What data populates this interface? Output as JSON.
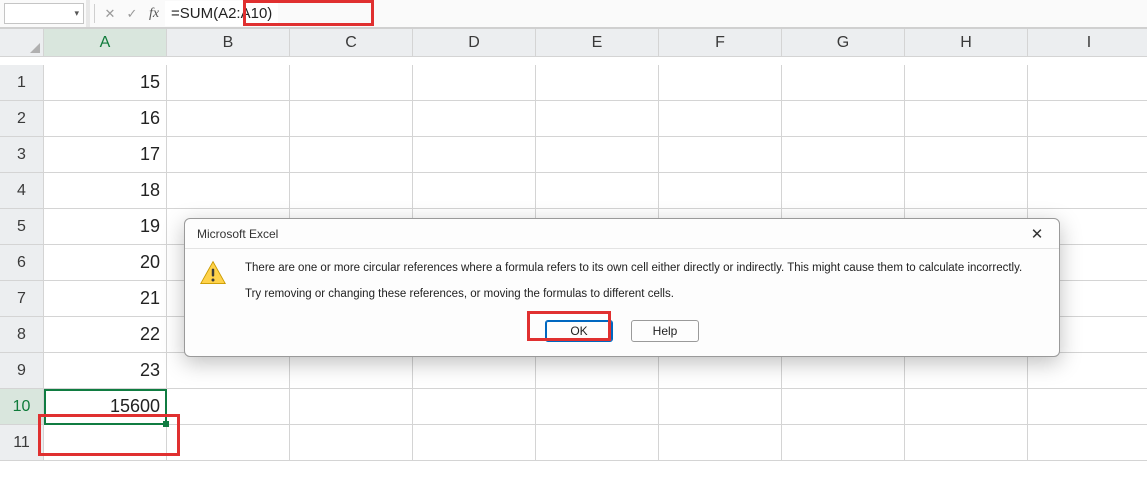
{
  "formula_bar": {
    "name_box": "",
    "formula": "=SUM(A2:A10)",
    "fx_label": "fx",
    "cancel_glyph": "✕",
    "confirm_glyph": "✓",
    "dropdown_glyph": "▾"
  },
  "columns": [
    "A",
    "B",
    "C",
    "D",
    "E",
    "F",
    "G",
    "H",
    "I"
  ],
  "rows": [
    {
      "n": 1,
      "A": "15"
    },
    {
      "n": 2,
      "A": "16"
    },
    {
      "n": 3,
      "A": "17"
    },
    {
      "n": 4,
      "A": "18"
    },
    {
      "n": 5,
      "A": "19"
    },
    {
      "n": 6,
      "A": "20"
    },
    {
      "n": 7,
      "A": "21"
    },
    {
      "n": 8,
      "A": "22"
    },
    {
      "n": 9,
      "A": "23"
    },
    {
      "n": 10,
      "A": "15600"
    },
    {
      "n": 11,
      "A": ""
    }
  ],
  "selected": {
    "col": "A",
    "row": 10
  },
  "dialog": {
    "title": "Microsoft Excel",
    "line1": "There are one or more circular references where a formula refers to its own cell either directly or indirectly. This might cause them to calculate incorrectly.",
    "line2": "Try removing or changing these references, or moving the formulas to different cells.",
    "ok": "OK",
    "help": "Help",
    "close_glyph": "✕"
  }
}
